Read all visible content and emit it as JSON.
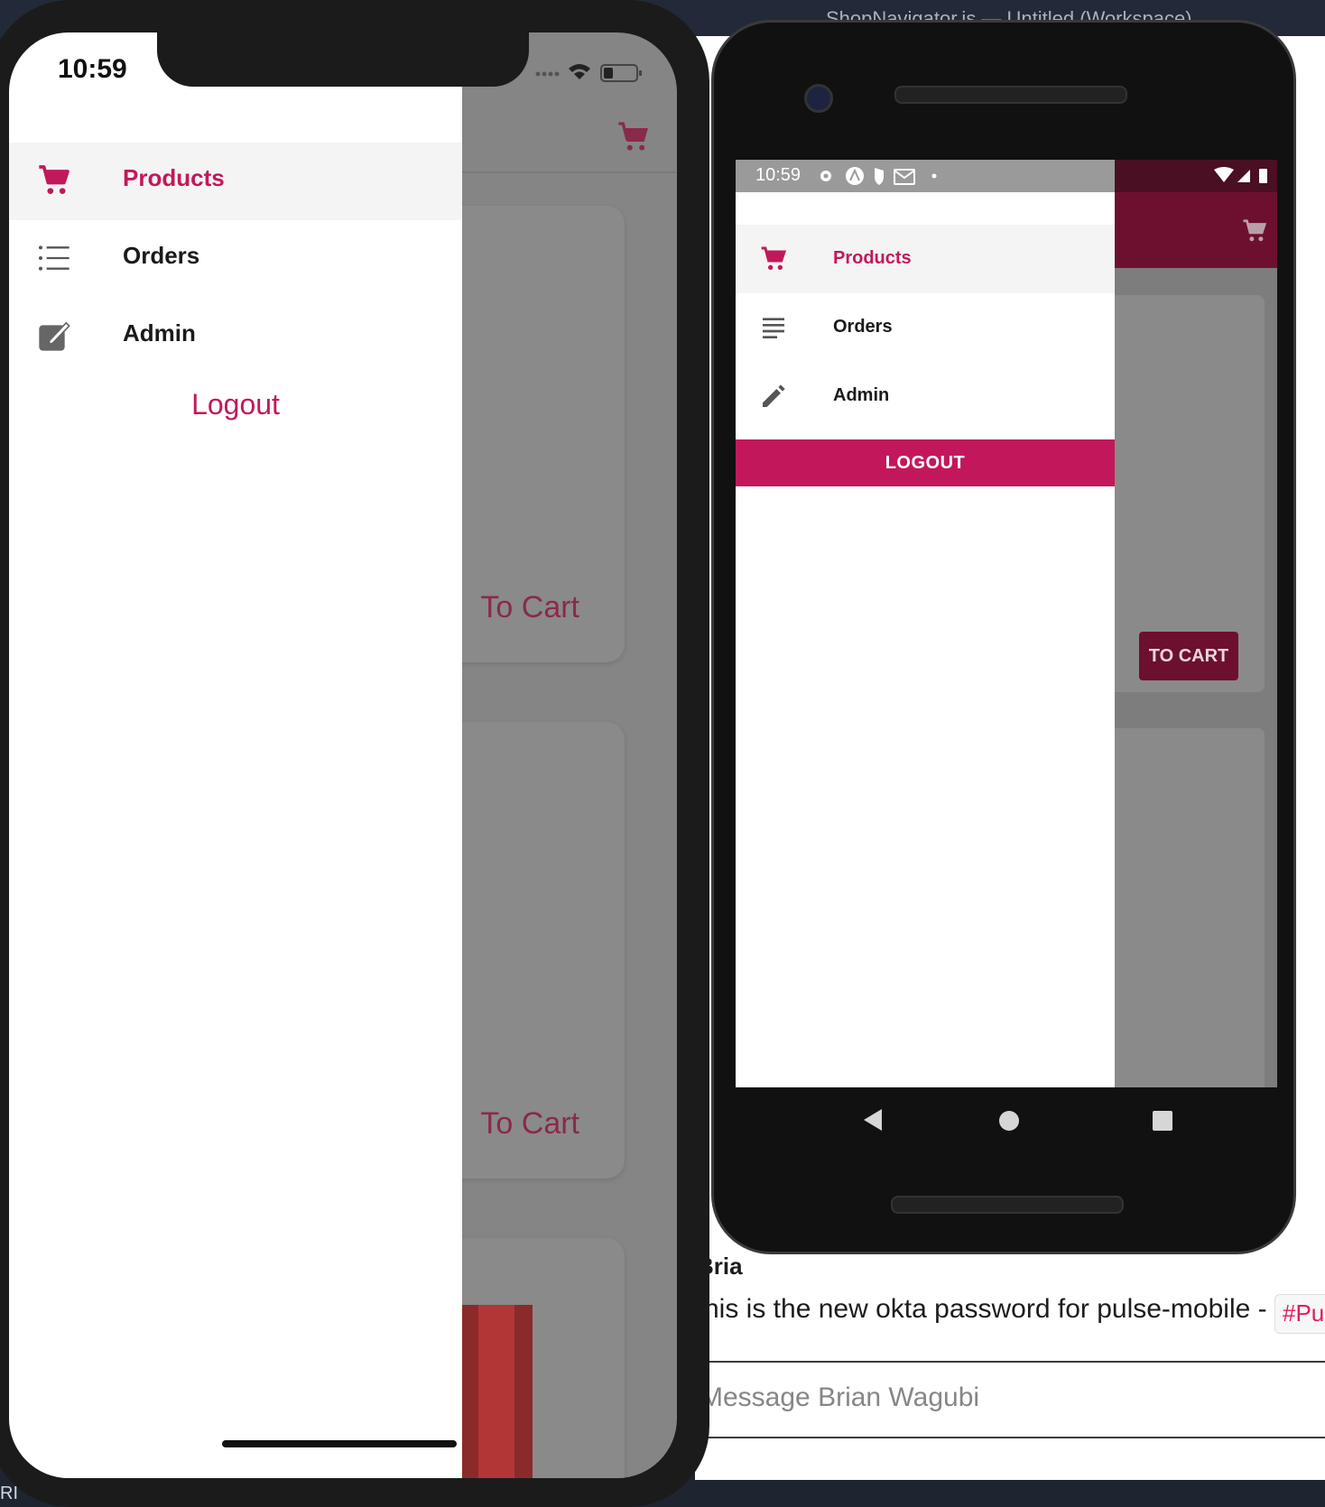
{
  "desktop": {
    "window_title": "ShopNavigator.js — Untitled (Workspace)",
    "footer_fragment": "RI",
    "chat": {
      "message": "his is the new okta password for pulse-mobile -",
      "tag": "#Pu",
      "input_placeholder": "Message Brian Wagubi",
      "sender_fragment": "Bria"
    }
  },
  "ios": {
    "status": {
      "time": "10:59"
    },
    "drawer": {
      "items": [
        {
          "label": "Products",
          "icon": "cart-icon",
          "active": true
        },
        {
          "label": "Orders",
          "icon": "list-icon",
          "active": false
        },
        {
          "label": "Admin",
          "icon": "edit-icon",
          "active": false
        }
      ],
      "logout": "Logout"
    },
    "content": {
      "cards": [
        {
          "button": "To Cart"
        },
        {
          "button": "To Cart"
        }
      ]
    }
  },
  "android": {
    "status": {
      "time": "10:59"
    },
    "drawer": {
      "items": [
        {
          "label": "Products",
          "icon": "cart-icon",
          "active": true
        },
        {
          "label": "Orders",
          "icon": "list-icon",
          "active": false
        },
        {
          "label": "Admin",
          "icon": "pencil-icon",
          "active": false
        }
      ],
      "logout": "LOGOUT"
    },
    "content": {
      "button": "TO CART"
    }
  },
  "colors": {
    "accent": "#c2185b",
    "appbar": "#6d1030",
    "overlay": "#858585"
  }
}
